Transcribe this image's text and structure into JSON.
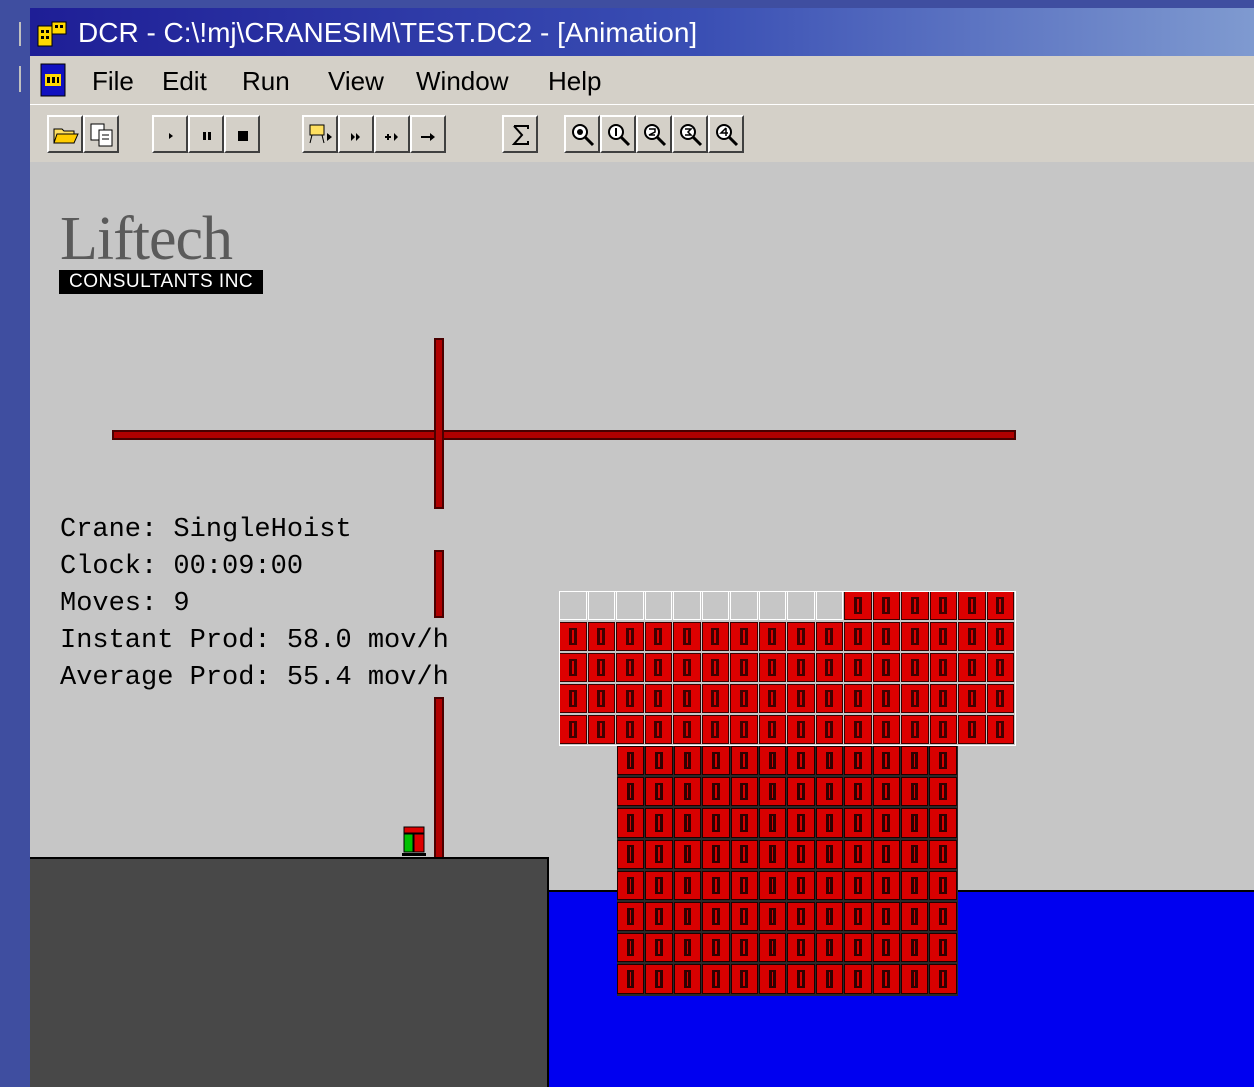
{
  "window": {
    "title": "DCR - C:\\!mj\\CRANESIM\\TEST.DC2 - [Animation]",
    "icon": "app-icon"
  },
  "menu": {
    "items": [
      {
        "label": "File"
      },
      {
        "label": "Edit"
      },
      {
        "label": "Run"
      },
      {
        "label": "View"
      },
      {
        "label": "Window"
      },
      {
        "label": "Help"
      }
    ]
  },
  "toolbar": {
    "buttons": [
      {
        "name": "open-icon"
      },
      {
        "name": "copy-icon"
      },
      {
        "name": "play-icon"
      },
      {
        "name": "pause-icon"
      },
      {
        "name": "stop-icon"
      },
      {
        "name": "run-to-icon"
      },
      {
        "name": "fast-forward-icon"
      },
      {
        "name": "step-into-icon"
      },
      {
        "name": "step-icon"
      },
      {
        "name": "sigma-icon"
      },
      {
        "name": "zoom-icon"
      },
      {
        "name": "zoom-1-icon"
      },
      {
        "name": "zoom-2-icon"
      },
      {
        "name": "zoom-3-icon"
      },
      {
        "name": "zoom-4-icon"
      }
    ]
  },
  "logo": {
    "name": "Liftech",
    "subtitle": "CONSULTANTS INC"
  },
  "stats": {
    "crane": "Crane: SingleHoist",
    "clock": "Clock: 00:09:00",
    "moves": "Moves: 9",
    "instant": "Instant Prod: 58.0 mov/h",
    "average": "Average Prod: 55.4 mov/h"
  },
  "scene": {
    "colors": {
      "container": "#dd0000",
      "beam": "#b00000",
      "water": "#0000f0",
      "quay": "#484848",
      "background": "#c6c6c6"
    },
    "deck": {
      "columns": 16,
      "rows": 5,
      "top_row_empty_columns": 10
    },
    "hold": {
      "columns": 12,
      "rows": 8
    }
  }
}
